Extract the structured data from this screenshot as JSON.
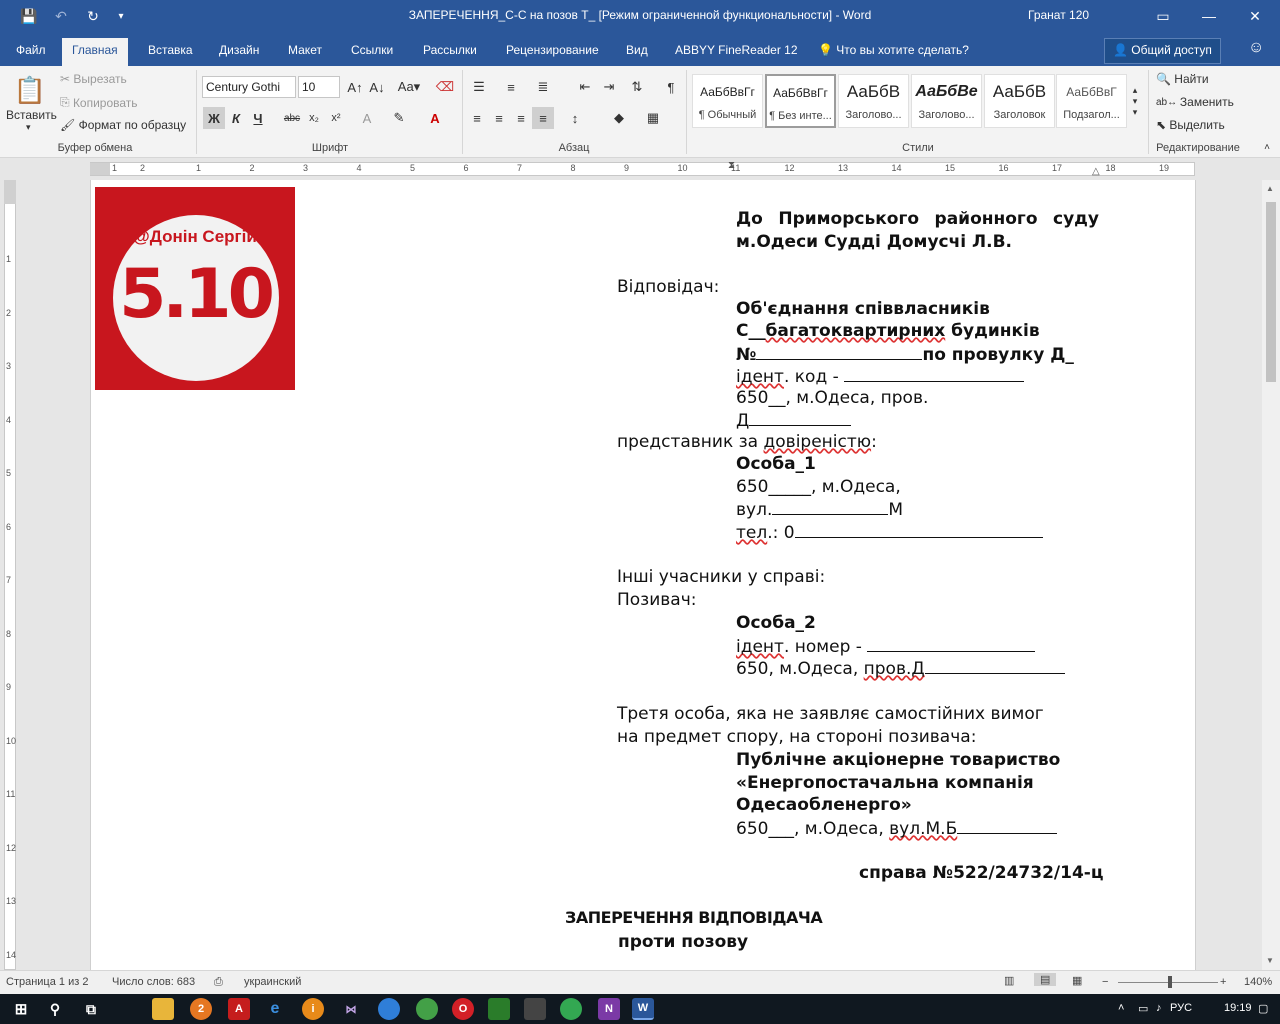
{
  "window": {
    "title": "ЗАПЕРЕЧЕННЯ_С-С на позов Т_ [Режим ограниченной функциональности] - Word",
    "user": "Гранат 120"
  },
  "tabs": [
    "Файл",
    "Главная",
    "Вставка",
    "Дизайн",
    "Макет",
    "Ссылки",
    "Рассылки",
    "Рецензирование",
    "Вид",
    "ABBYY FineReader 12"
  ],
  "tell_me": "Что вы хотите сделать?",
  "share": "Общий доступ",
  "ribbon": {
    "clipboard": {
      "paste": "Вставить",
      "cut": "Вырезать",
      "copy": "Копировать",
      "format_painter": "Формат по образцу",
      "label": "Буфер обмена"
    },
    "font": {
      "name": "Century Gothi",
      "size": "10",
      "bold": "Ж",
      "italic": "К",
      "underline": "Ч",
      "strike": "abc",
      "sub": "x₂",
      "sup": "x²",
      "label": "Шрифт"
    },
    "paragraph": {
      "label": "Абзац"
    },
    "styles": {
      "items": [
        {
          "preview": "АаБбВвГг",
          "name": "¶ Обычный"
        },
        {
          "preview": "АаБбВвГг",
          "name": "¶ Без инте..."
        },
        {
          "preview": "АаБбВ",
          "name": "Заголово..."
        },
        {
          "preview": "АаБбВе",
          "name": "Заголово..."
        },
        {
          "preview": "АаБбВ",
          "name": "Заголовок"
        },
        {
          "preview": "АаБбВвГ",
          "name": "Подзагол..."
        }
      ],
      "label": "Стили"
    },
    "editing": {
      "find": "Найти",
      "replace": "Заменить",
      "select": "Выделить",
      "label": "Редактирование"
    }
  },
  "ruler": {
    "h_ticks": [
      "1",
      "2",
      "1",
      "2",
      "3",
      "4",
      "5",
      "6",
      "7",
      "8",
      "9",
      "10",
      "11",
      "12",
      "13",
      "14",
      "15",
      "16",
      "17",
      "18",
      "19"
    ],
    "v_ticks": [
      "1",
      "2",
      "3",
      "4",
      "5",
      "6",
      "7",
      "8",
      "9",
      "10",
      "11",
      "12",
      "13",
      "14"
    ]
  },
  "logo": {
    "handle": "@Донін Сергій",
    "number": "5.10"
  },
  "document": {
    "court_line1": "До Приморського районного суду",
    "court_line2": "м.Одеси Судді Домусчі Л.В.",
    "respondent_label": "Відповідач:",
    "org_line1": "Об'єднання співвласників",
    "org_line2_a": "С__",
    "org_line2_b": "багатоквартирних",
    "org_line2_c": " будинків",
    "org_line3_a": "№",
    "org_line3_b": "по провулку Д_",
    "ident_code_a": "ідент",
    "ident_code_b": ". код - ",
    "address1": "650__, м.Одеса, пров.",
    "address1b": "Д",
    "representative_label_a": "представник за ",
    "representative_label_b": "довіреністю",
    "representative_label_c": ":",
    "person1": "Особа_1",
    "p1_addr1": "650_____, м.Одеса,",
    "p1_addr2_a": "вул.",
    "p1_addr2_b": "М",
    "p1_phone_a": "тел",
    "p1_phone_b": ".: 0",
    "others_label": "Інші учасники у справі:",
    "plaintiff_label": "Позивач:",
    "person2": "Особа_2",
    "p2_ident_a": "ідент",
    "p2_ident_b": ". номер - ",
    "p2_addr_a": "650, м.Одеса, ",
    "p2_addr_b": "пров.Д",
    "third_label1": "Третя особа, яка не заявляє самостійних вимог",
    "third_label2": "на предмет спору, на стороні позивача:",
    "third1": "Публічне акціонерне товариство",
    "third2": "«Енергопостачальна компанія",
    "third3": "Одесаобленерго»",
    "third_addr_a": "650___, м.Одеса, ",
    "third_addr_b": "вул.М.Б",
    "case_no": "справа №522/24732/14-ц",
    "heading": "ЗАПЕРЕЧЕННЯ ВІДПОВІДАЧА",
    "subheading": "проти позову"
  },
  "status": {
    "page": "Страница 1 из 2",
    "words": "Число слов: 683",
    "lang": "украинский",
    "zoom": "140%"
  },
  "taskbar": {
    "lang": "РУС",
    "time": "19:19"
  },
  "colors": {
    "word_blue": "#2b579a",
    "logo_red": "#c8161e"
  }
}
